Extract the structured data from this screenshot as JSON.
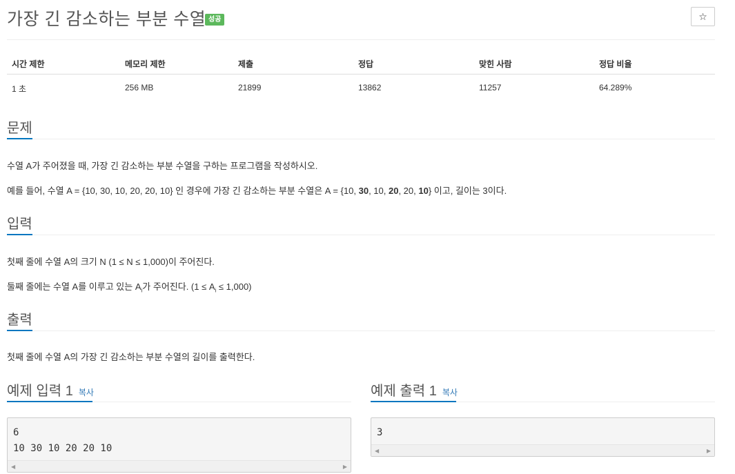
{
  "header": {
    "title": "가장 긴 감소하는 부분 수열",
    "badge": "성공",
    "star": "☆"
  },
  "info": {
    "headers": [
      "시간 제한",
      "메모리 제한",
      "제출",
      "정답",
      "맞힌 사람",
      "정답 비율"
    ],
    "values": [
      "1 초",
      "256 MB",
      "21899",
      "13862",
      "11257",
      "64.289%"
    ]
  },
  "problem": {
    "title": "문제",
    "line1": "수열 A가 주어졌을 때, 가장 긴 감소하는 부분 수열을 구하는 프로그램을 작성하시오.",
    "line2_pre": "예를 들어, 수열 A = {10, 30, 10, 20, 20, 10} 인 경우에 가장 긴 감소하는 부분 수열은 A = {10, ",
    "line2_b1": "30",
    "line2_mid1": ", 10, ",
    "line2_b2": "20",
    "line2_mid2": ", 20, ",
    "line2_b3": "10",
    "line2_post": "}  이고, 길이는 3이다."
  },
  "input": {
    "title": "입력",
    "line1": "첫째 줄에 수열 A의 크기 N (1 ≤ N ≤ 1,000)이 주어진다.",
    "line2_pre": "둘째 줄에는 수열 A를 이루고 있는 A",
    "line2_sub": "i",
    "line2_mid": "가 주어진다. (1 ≤ A",
    "line2_sub2": "i",
    "line2_post": " ≤ 1,000)"
  },
  "output": {
    "title": "출력",
    "line1": "첫째 줄에 수열 A의 가장 긴 감소하는 부분 수열의 길이를 출력한다."
  },
  "samples": {
    "input_title": "예제 입력 1",
    "output_title": "예제 출력 1",
    "copy_label": "복사",
    "input_text": "6\n10 30 10 20 20 10",
    "output_text": "3"
  }
}
